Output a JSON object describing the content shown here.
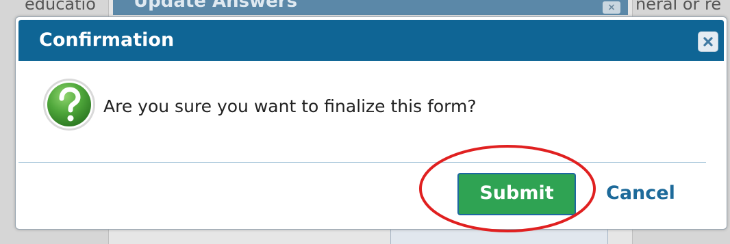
{
  "background": {
    "left_text": "educatio",
    "panel_title": "Update Answers",
    "right_text": "neral or re",
    "panel_close_icon": "close-icon"
  },
  "dialog": {
    "title": "Confirmation",
    "close_icon": "close-icon",
    "message_icon": "question-icon",
    "message": "Are you sure you want to finalize this form?",
    "submit_label": "Submit",
    "cancel_label": "Cancel"
  },
  "colors": {
    "titlebar": "#0f6595",
    "submit_button": "#2fa353",
    "cancel_link": "#1d6a9a",
    "annotation_circle": "#e02020",
    "question_icon": "#4ea63a"
  }
}
